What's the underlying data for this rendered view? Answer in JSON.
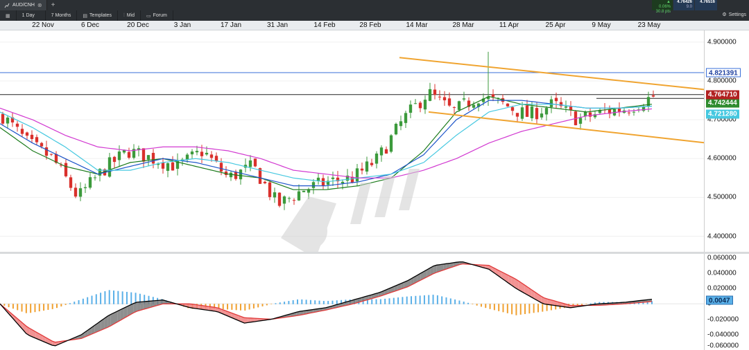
{
  "toolbar": {
    "symbol_tab": "AUD/CNH",
    "interval": "1 Day",
    "range": "7 Months",
    "templates": "Templates",
    "price_type": "Mid",
    "forum": "Forum",
    "settings": "Settings",
    "change_pct": "▲ 0.06%",
    "change_pts": "30.8 pts",
    "bid": "4.76426",
    "spread": "9.0",
    "ask": "4.76516"
  },
  "icons": {
    "chart": "chart-icon",
    "close": "close-icon",
    "add": "add-tab-icon",
    "layout": "layout-icon",
    "templates": "templates-icon",
    "price_type": "candlestick-icon",
    "forum": "chat-icon",
    "settings": "gear-icon"
  },
  "colors": {
    "up_candle": "#3c9a3c",
    "down_candle": "#d9302c",
    "sma_short": "#1a7a1a",
    "sma_mid": "#1d55c9",
    "sma_long": "#45c8e0",
    "sma_longest": "#d23ad1",
    "channel": "#f0a430",
    "resistance": "#3a6fd8",
    "macd_line": "#000000",
    "signal_line": "#e03a3a",
    "hist_pos": "#5ab0e8",
    "hist_neg": "#f0a030"
  },
  "chart_data": [
    {
      "type": "candlestick",
      "title": "",
      "x_dates": [
        "22 Nov",
        "6 Dec",
        "20 Dec",
        "3 Jan",
        "17 Jan",
        "31 Jan",
        "14 Feb",
        "28 Feb",
        "14 Mar",
        "28 Mar",
        "11 Apr",
        "25 Apr",
        "9 May",
        "23 May"
      ],
      "ylim": [
        4.36,
        4.93
      ],
      "y_ticks": [
        "4.900000",
        "4.800000",
        "4.700000",
        "4.600000",
        "4.500000",
        "4.400000"
      ],
      "close_path": [
        4.71,
        4.64,
        4.6,
        4.5,
        4.57,
        4.62,
        4.6,
        4.58,
        4.62,
        4.55,
        4.58,
        4.48,
        4.52,
        4.54,
        4.55,
        4.6,
        4.7,
        4.77,
        4.72,
        4.76,
        4.74,
        4.71,
        4.74,
        4.7,
        4.72,
        4.73,
        4.76
      ],
      "moving_averages": [
        {
          "values": [
            4.68,
            4.62,
            4.58,
            4.56,
            4.59,
            4.6,
            4.58,
            4.56,
            4.55,
            4.52,
            4.52,
            4.53,
            4.55,
            4.62,
            4.72,
            4.76,
            4.74,
            4.73,
            4.72,
            4.73,
            4.74
          ]
        },
        {
          "values": [
            4.69,
            4.64,
            4.6,
            4.56,
            4.58,
            4.6,
            4.59,
            4.57,
            4.55,
            4.53,
            4.53,
            4.54,
            4.56,
            4.61,
            4.7,
            4.75,
            4.75,
            4.74,
            4.73,
            4.73,
            4.735
          ]
        },
        {
          "values": [
            4.72,
            4.68,
            4.63,
            4.57,
            4.57,
            4.59,
            4.6,
            4.59,
            4.57,
            4.55,
            4.54,
            4.55,
            4.56,
            4.59,
            4.66,
            4.72,
            4.74,
            4.74,
            4.73,
            4.73,
            4.735
          ]
        },
        {
          "values": [
            4.73,
            4.7,
            4.66,
            4.63,
            4.62,
            4.63,
            4.63,
            4.62,
            4.6,
            4.57,
            4.56,
            4.55,
            4.55,
            4.57,
            4.6,
            4.64,
            4.67,
            4.69,
            4.71,
            4.72,
            4.728
          ]
        }
      ],
      "channel_upper": {
        "from": [
          "14 Mar",
          4.86
        ],
        "to": [
          "end",
          4.778
        ]
      },
      "channel_lower": {
        "from": [
          "14 Mar",
          4.72
        ],
        "to": [
          "end",
          4.641
        ]
      },
      "horizontal_levels": [
        {
          "value": 4.821391,
          "label": "4.821391",
          "color": "#3a6fd8"
        },
        {
          "value": 4.76471,
          "label": "4.764710",
          "color": "#b22222"
        },
        {
          "value": 4.742444,
          "label": "4.742444",
          "color": "#2e8b2e"
        },
        {
          "value": 4.72128,
          "label": "4.721280",
          "color": "#45c8e0"
        }
      ]
    },
    {
      "type": "area",
      "title": "",
      "ylim": [
        -0.06,
        0.065
      ],
      "y_ticks": [
        "0.060000",
        "0.040000",
        "0.020000",
        "0",
        "-0.020000",
        "-0.040000",
        "-0.060000"
      ],
      "macd_line": [
        0.0,
        -0.04,
        -0.055,
        -0.04,
        -0.015,
        0.002,
        0.005,
        -0.005,
        -0.01,
        -0.025,
        -0.02,
        -0.01,
        -0.005,
        0.005,
        0.015,
        0.03,
        0.05,
        0.055,
        0.045,
        0.02,
        0.0,
        -0.005,
        0.0,
        0.002,
        0.006
      ],
      "signal_line": [
        0.0,
        -0.03,
        -0.05,
        -0.045,
        -0.03,
        -0.01,
        0.0,
        0.0,
        -0.005,
        -0.018,
        -0.02,
        -0.015,
        -0.008,
        0.0,
        0.01,
        0.022,
        0.04,
        0.052,
        0.05,
        0.032,
        0.008,
        -0.002,
        -0.002,
        0.0,
        0.003
      ],
      "last_value_label": "0.0047"
    }
  ]
}
